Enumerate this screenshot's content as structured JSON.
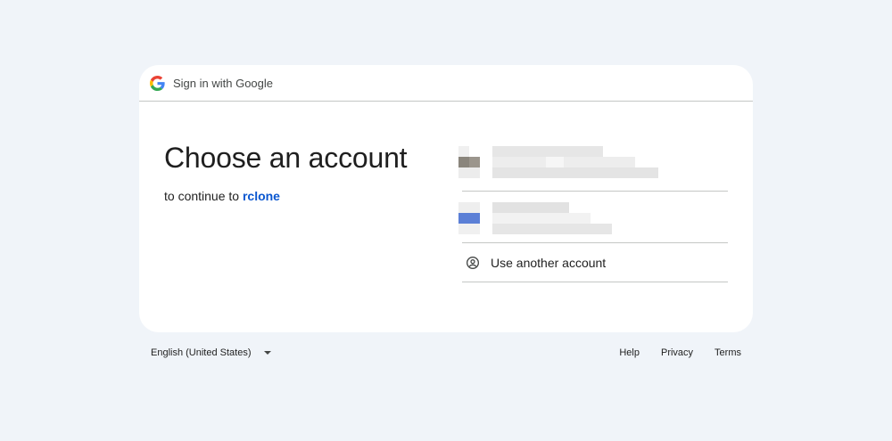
{
  "header": {
    "title": "Sign in with Google",
    "logo_icon": "google-g-icon"
  },
  "main": {
    "title": "Choose an account",
    "subtitle_prefix": "to continue to",
    "app_name": "rclone"
  },
  "accounts": {
    "rows": [
      {
        "state": "redacted-pixelated",
        "avatar_color": "#8a857c"
      },
      {
        "state": "redacted-pixelated",
        "avatar_color": "#5b7fd6"
      }
    ],
    "use_another_label": "Use another account",
    "use_another_icon": "account-circle-icon"
  },
  "footer": {
    "language": "English (United States)",
    "language_icon": "dropdown-caret-icon",
    "links": [
      "Help",
      "Privacy",
      "Terms"
    ]
  },
  "colors": {
    "background": "#f0f4f9",
    "card": "#ffffff",
    "link": "#0b57d0",
    "divider": "#c4c7c5"
  }
}
